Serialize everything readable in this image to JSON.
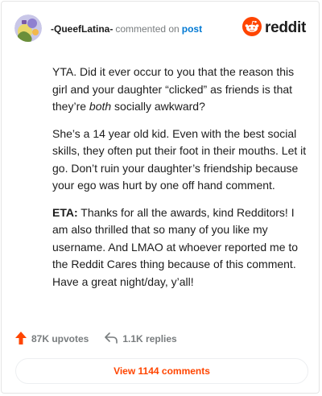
{
  "header": {
    "username": "-QueefLatina-",
    "action": "commented on",
    "post_link": "post",
    "brand": "reddit",
    "avatar_icon": "user-avatar-icon",
    "brand_icon": "reddit-logo-icon"
  },
  "comment": {
    "p1": "YTA. Did it ever occur to you that the reason this girl and your daughter “clicked” as friends is that they’re ",
    "p1_em": "both",
    "p1_tail": " socially awkward?",
    "p2": "She’s a 14 year old kid. Even with the best social skills, they often put their foot in their mouths. Let it go. Don’t ruin your daughter’s friendship because your ego was hurt by one off hand comment.",
    "p3_strong": "ETA:",
    "p3": " Thanks for all the awards, kind Redditors! I am also thrilled that so many of you like my username. And LMAO at whoever reported me to the Reddit Cares thing because of this comment. Have a great night/day, y’all!"
  },
  "footer": {
    "upvotes": "87K upvotes",
    "replies": "1.1K replies",
    "upvote_icon": "upvote-arrow-icon",
    "reply_icon": "reply-arrow-icon"
  },
  "view_button": "View 1144 comments",
  "colors": {
    "brand": "#ff4500",
    "link": "#0079d3",
    "muted": "#787c7e",
    "text": "#1c1c1c"
  }
}
